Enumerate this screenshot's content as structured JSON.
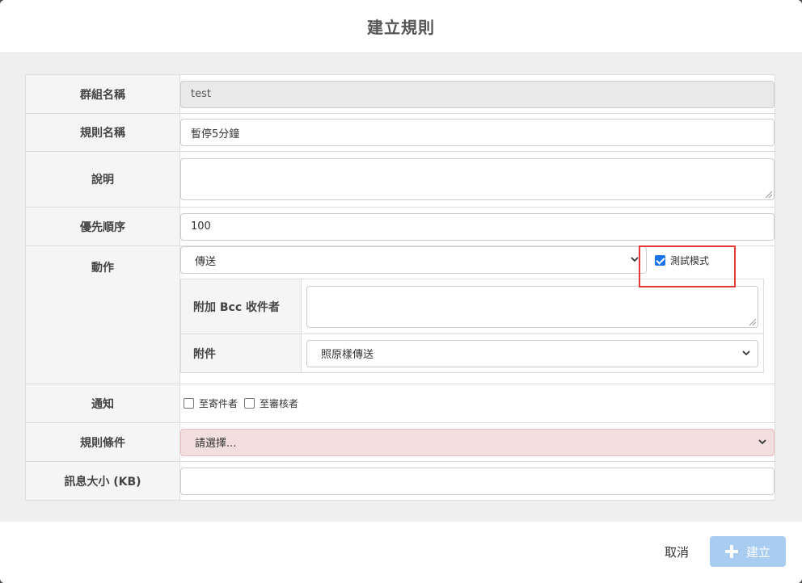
{
  "dialog": {
    "title": "建立規則"
  },
  "form": {
    "group_name": {
      "label": "群組名稱",
      "value": "test"
    },
    "rule_name": {
      "label": "規則名稱",
      "value": "暫停5分鐘"
    },
    "description": {
      "label": "說明",
      "value": ""
    },
    "priority": {
      "label": "優先順序",
      "value": "100"
    },
    "action": {
      "label": "動作",
      "selected": "傳送",
      "test_mode_label": "測試模式",
      "test_mode_checked": true,
      "bcc": {
        "label": "附加 Bcc 收件者",
        "value": ""
      },
      "attachment": {
        "label": "附件",
        "selected": "照原樣傳送"
      }
    },
    "notify": {
      "label": "通知",
      "options": [
        {
          "label": "至寄件者",
          "checked": false
        },
        {
          "label": "至審核者",
          "checked": false
        }
      ]
    },
    "conditions": {
      "label": "規則條件",
      "selected": "請選擇..."
    },
    "message_size": {
      "label": "訊息大小 (KB)",
      "value": ""
    }
  },
  "footer": {
    "cancel_label": "取消",
    "create_label": "建立"
  },
  "colors": {
    "highlight": "#e53935",
    "create_button": "#a9cdf0",
    "condition_bg": "#f2dede"
  }
}
